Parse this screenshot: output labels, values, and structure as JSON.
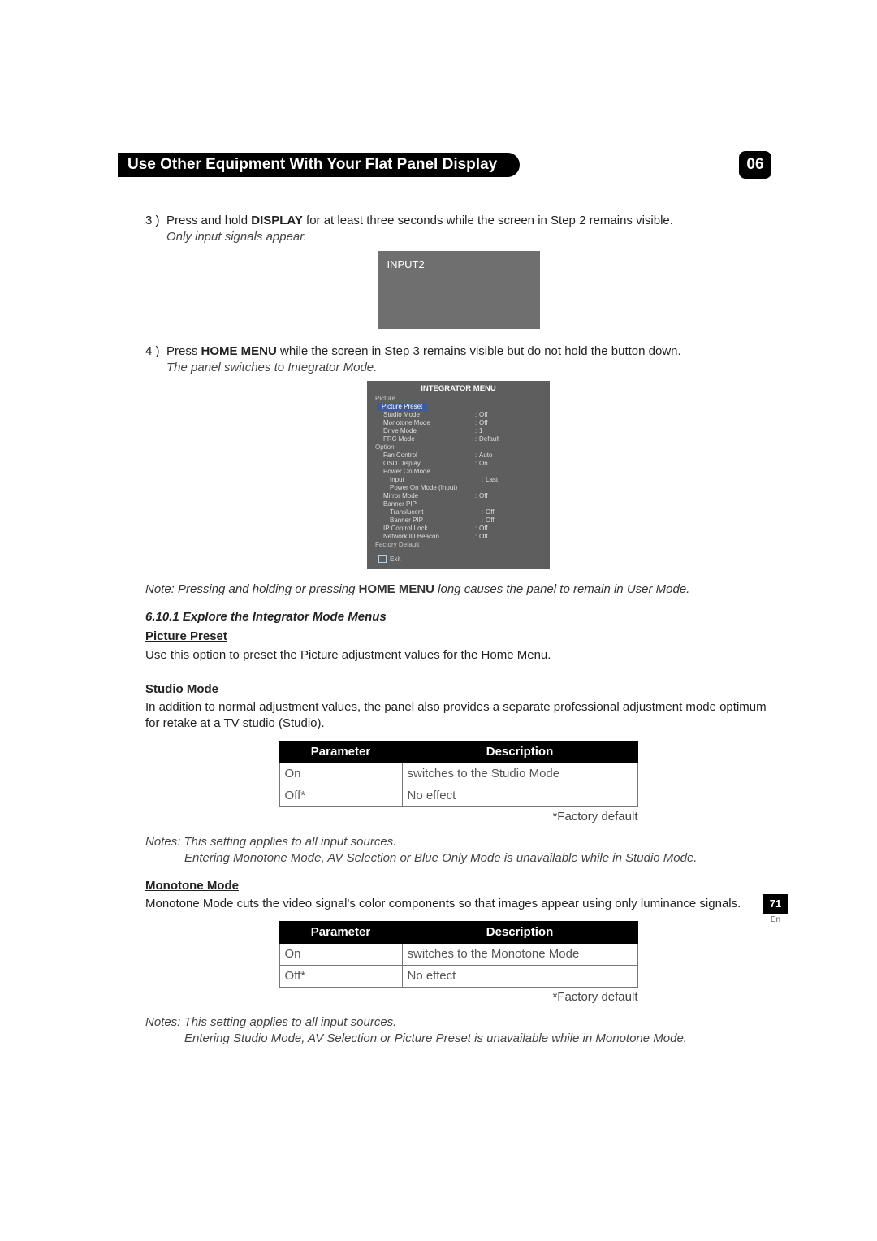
{
  "header": {
    "title": "Use Other Equipment With Your Flat Panel Display",
    "chapter": "06"
  },
  "step3": {
    "num": "3 )",
    "pre": "Press and hold ",
    "key": "DISPLAY",
    "post": " for at least three seconds while the screen in Step 2 remains visible.",
    "italic": "Only input signals appear."
  },
  "osd1": {
    "label": "INPUT2"
  },
  "step4": {
    "num": "4 )",
    "pre": "Press ",
    "key": "HOME MENU",
    "post": " while the screen in Step 3 remains visible but do not hold the button down.",
    "italic": "The panel switches to Integrator Mode."
  },
  "integrator": {
    "title": "INTEGRATOR MENU",
    "picture_label": "Picture",
    "highlight": "Picture Preset",
    "picture_rows": [
      {
        "k": "Studio Mode",
        "v": "Off"
      },
      {
        "k": "Monotone Mode",
        "v": "Off"
      },
      {
        "k": "Drive Mode",
        "v": "1"
      },
      {
        "k": "FRC Mode",
        "v": "Default"
      }
    ],
    "option_label": "Option",
    "option_rows": [
      {
        "k": "Fan Control",
        "v": "Auto"
      },
      {
        "k": "OSD Display",
        "v": "On"
      },
      {
        "k": "Power On Mode",
        "v": ""
      },
      {
        "k": "Input",
        "v": "Last",
        "indent": true
      },
      {
        "k": "Power On Mode (Input)",
        "v": "",
        "indent": true
      },
      {
        "k": "Mirror Mode",
        "v": "Off"
      },
      {
        "k": "Banner PIP",
        "v": ""
      },
      {
        "k": "Translucent",
        "v": "Off",
        "indent": true
      },
      {
        "k": "Banner PIP",
        "v": "Off",
        "indent": true
      },
      {
        "k": "IP Control Lock",
        "v": "Off"
      },
      {
        "k": "Network ID Beacon",
        "v": "Off"
      }
    ],
    "factory_default": "Factory Default",
    "exit": "Exit"
  },
  "note_after_menu": {
    "pre": "Note: Pressing and holding or pressing ",
    "key": "HOME MENU",
    "post": " long causes the panel to remain in User Mode."
  },
  "subheading": "6.10.1  Explore the Integrator Mode Menus",
  "picture_preset": {
    "title": "Picture Preset",
    "body": "Use this option to preset the Picture adjustment values for the Home Menu."
  },
  "studio_mode": {
    "title": "Studio Mode",
    "body": "In addition to normal adjustment values, the panel also provides a separate professional adjustment mode optimum for retake at a TV studio (Studio).",
    "table": {
      "h1": "Parameter",
      "h2": "Description",
      "rows": [
        {
          "p": "On",
          "d": "switches to the Studio Mode"
        },
        {
          "p": "Off*",
          "d": "No effect"
        }
      ]
    },
    "fd": "*Factory default",
    "notes": {
      "l1": "Notes: This setting applies to all input sources.",
      "l2": "Entering Monotone Mode, AV Selection or Blue Only Mode is unavailable while in Studio Mode."
    }
  },
  "monotone_mode": {
    "title": "Monotone Mode",
    "body": "Monotone Mode cuts the video signal's color components so that images appear using only luminance signals.",
    "table": {
      "h1": "Parameter",
      "h2": "Description",
      "rows": [
        {
          "p": "On",
          "d": "switches to the Monotone Mode"
        },
        {
          "p": "Off*",
          "d": "No effect"
        }
      ]
    },
    "fd": "*Factory default",
    "notes": {
      "l1": "Notes: This setting applies to all input sources.",
      "l2": "Entering Studio Mode, AV Selection or Picture Preset is unavailable while in Monotone Mode."
    }
  },
  "footer": {
    "page": "71",
    "lang": "En"
  }
}
